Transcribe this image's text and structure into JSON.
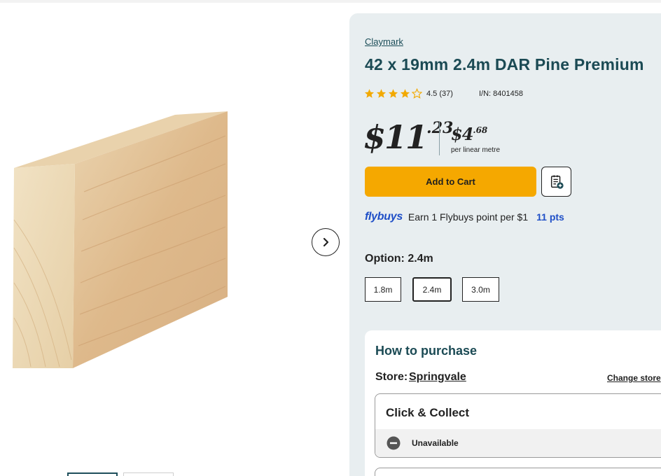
{
  "product": {
    "brand": "Claymark",
    "title": "42 x 19mm 2.4m DAR Pine Premium",
    "rating": "4.5 (37)",
    "item_number": "I/N: 8401458",
    "price_dollars": "$11",
    "price_cents": ".23",
    "unit_price_dollars": "$4",
    "unit_price_cents": ".68",
    "unit_price_label": "per linear metre"
  },
  "actions": {
    "add_to_cart_label": "Add to Cart"
  },
  "flybuys": {
    "logo": "flybuys",
    "text": "Earn 1 Flybuys point per $1",
    "points": "11 pts"
  },
  "options": {
    "label": "Option: 2.4m",
    "items": [
      "1.8m",
      "2.4m",
      "3.0m"
    ],
    "selected": "2.4m"
  },
  "purchase": {
    "title": "How to purchase",
    "store_label": "Store:",
    "store_name": "Springvale",
    "change_store": "Change store",
    "click_collect_title": "Click & Collect",
    "click_collect_status": "Unavailable"
  },
  "colors": {
    "accent_yellow": "#f5a800",
    "heading_teal": "#1b4a54",
    "flybuys_blue": "#1f4fc7",
    "star_gold": "#f2a900",
    "panel_bg": "#e8eef0"
  },
  "icons": {
    "rating_stars": "star-icon",
    "next_image": "chevron-right-icon",
    "shopping_list": "add-to-list-icon",
    "status": "minus-circle-icon"
  }
}
